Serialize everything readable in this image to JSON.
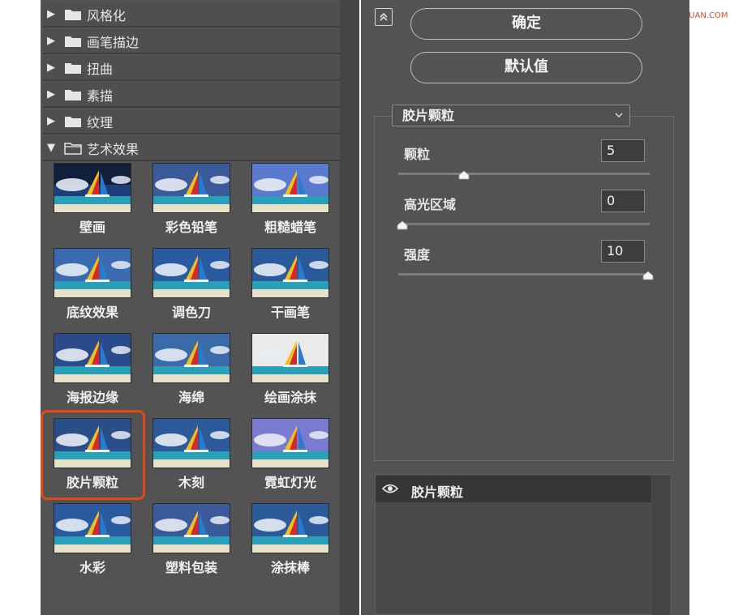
{
  "watermark": "思缘设计论坛 WWW.MISSYUAN.COM",
  "categories": [
    {
      "label": "风格化",
      "expanded": false
    },
    {
      "label": "画笔描边",
      "expanded": false
    },
    {
      "label": "扭曲",
      "expanded": false
    },
    {
      "label": "素描",
      "expanded": false
    },
    {
      "label": "纹理",
      "expanded": false
    },
    {
      "label": "艺术效果",
      "expanded": true
    }
  ],
  "filters": [
    {
      "label": "壁画"
    },
    {
      "label": "彩色铅笔"
    },
    {
      "label": "粗糙蜡笔"
    },
    {
      "label": "底纹效果"
    },
    {
      "label": "调色刀"
    },
    {
      "label": "干画笔"
    },
    {
      "label": "海报边缘"
    },
    {
      "label": "海绵"
    },
    {
      "label": "绘画涂抹"
    },
    {
      "label": "胶片颗粒",
      "selected": true
    },
    {
      "label": "木刻"
    },
    {
      "label": "霓虹灯光"
    },
    {
      "label": "水彩"
    },
    {
      "label": "塑料包装"
    },
    {
      "label": "涂抹棒"
    }
  ],
  "buttons": {
    "ok": "确定",
    "default": "默认值"
  },
  "filter_select": {
    "value": "胶片颗粒"
  },
  "params": [
    {
      "label": "颗粒",
      "value": "5",
      "fraction": 0.25
    },
    {
      "label": "高光区域",
      "value": "0",
      "fraction": 0.0
    },
    {
      "label": "强度",
      "value": "10",
      "fraction": 1.0
    }
  ],
  "layer": {
    "name": "胶片颗粒"
  },
  "colors": {
    "accent_selected": "#e04a1a",
    "panel": "#535353"
  }
}
